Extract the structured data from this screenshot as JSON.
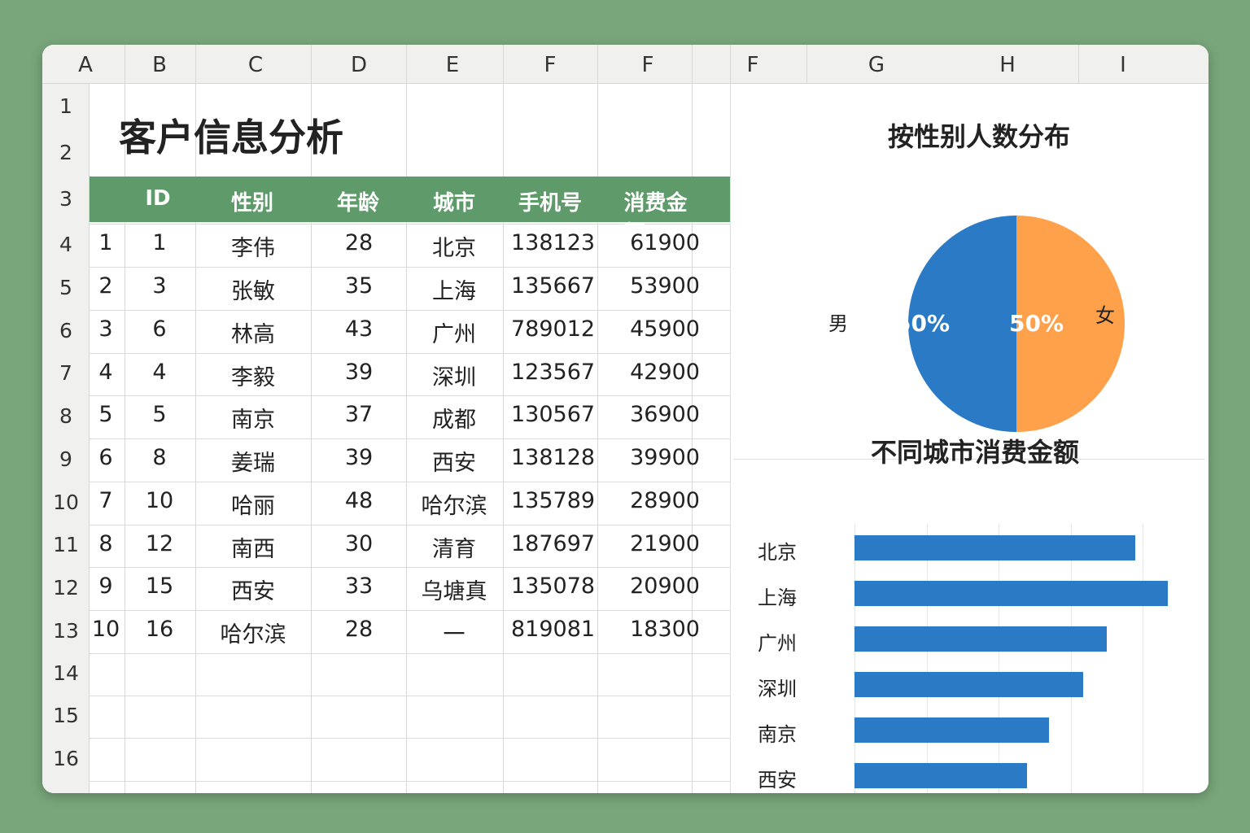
{
  "columns": [
    "A",
    "B",
    "C",
    "D",
    "E",
    "F",
    "F",
    "F",
    "G",
    "H",
    "I"
  ],
  "rows": [
    "1",
    "2",
    "3",
    "4",
    "5",
    "6",
    "7",
    "8",
    "9",
    "10",
    "11",
    "12",
    "13",
    "14",
    "15",
    "16"
  ],
  "sheet_title": "客户信息分析",
  "table": {
    "headers": [
      "ID",
      "性别",
      "年龄",
      "城市",
      "手机号",
      "消费金额"
    ],
    "rows": [
      [
        "1",
        "1",
        "李伟",
        "28",
        "北京",
        "138123",
        "61900"
      ],
      [
        "2",
        "3",
        "张敏",
        "35",
        "上海",
        "135667",
        "53900"
      ],
      [
        "3",
        "6",
        "林高",
        "43",
        "广州",
        "789012",
        "45900"
      ],
      [
        "4",
        "4",
        "李毅",
        "39",
        "深圳",
        "123567",
        "42900"
      ],
      [
        "5",
        "5",
        "南京",
        "37",
        "成都",
        "130567",
        "36900"
      ],
      [
        "6",
        "8",
        "姜瑞",
        "39",
        "西安",
        "138128",
        "39900"
      ],
      [
        "7",
        "10",
        "哈丽",
        "48",
        "哈尔滨",
        "135789",
        "28900"
      ],
      [
        "8",
        "12",
        "南西",
        "30",
        "清育",
        "187697",
        "21900"
      ],
      [
        "9",
        "15",
        "西安",
        "33",
        "乌塘真",
        "135078",
        "20900"
      ],
      [
        "10",
        "16",
        "哈尔滨",
        "28",
        "一",
        "819081",
        "18300"
      ]
    ]
  },
  "pie": {
    "title": "按性别人数分布",
    "slices": [
      {
        "label": "男",
        "value": 50,
        "text": "50%",
        "color": "#2a7ac6"
      },
      {
        "label": "女",
        "value": 50,
        "text": "50%",
        "color": "#ffa04a"
      }
    ]
  },
  "chart_data": {
    "type": "bar",
    "title": "不同城市消费金额",
    "categories": [
      "北京",
      "上海",
      "广州",
      "深圳",
      "南京",
      "西安"
    ],
    "values": [
      39000,
      43500,
      35000,
      31800,
      27000,
      24000
    ],
    "xticks": [
      "0",
      "10 000",
      "20 000",
      "30 000",
      "40 000",
      "60 000"
    ],
    "color": "#2a7ac6"
  }
}
